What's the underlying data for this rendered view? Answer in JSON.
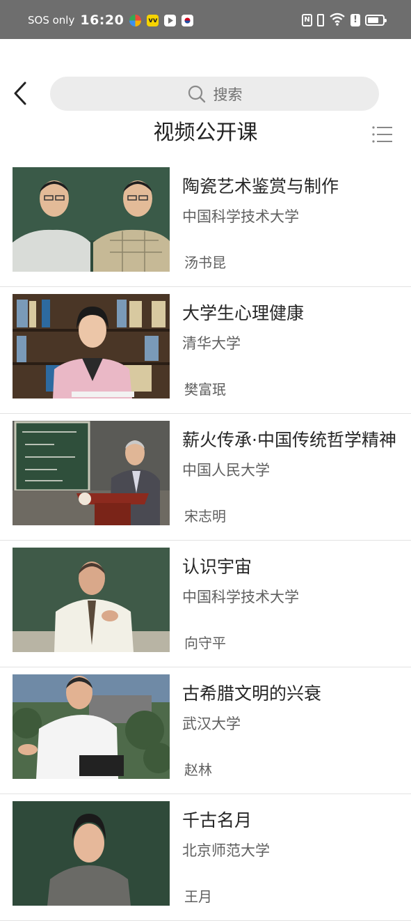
{
  "status_bar": {
    "network": "SOS only",
    "time": "16:20",
    "app_icons": [
      {
        "name": "pinwheel-app-icon",
        "color": "#f0a000"
      },
      {
        "name": "vv-app-icon",
        "color": "#f6d400"
      },
      {
        "name": "play-app-icon",
        "color": "#ffffff"
      },
      {
        "name": "flag-app-icon",
        "color": "#ffffff"
      }
    ],
    "nfc_label": "N",
    "alert_label": "!",
    "battery_level": 0.75
  },
  "header": {
    "search_placeholder": "搜索",
    "title": "视频公开课"
  },
  "courses": [
    {
      "title": "陶瓷艺术鉴赏与制作",
      "school": "中国科学技术大学",
      "teacher": "汤书昆"
    },
    {
      "title": "大学生心理健康",
      "school": "清华大学",
      "teacher": "樊富珉"
    },
    {
      "title": "薪火传承·中国传统哲学精神",
      "school": "中国人民大学",
      "teacher": "宋志明"
    },
    {
      "title": "认识宇宙",
      "school": "中国科学技术大学",
      "teacher": "向守平"
    },
    {
      "title": "古希腊文明的兴衰",
      "school": "武汉大学",
      "teacher": "赵林"
    },
    {
      "title": "千古名月",
      "school": "北京师范大学",
      "teacher": "王月"
    }
  ],
  "colors": {
    "status_bar": "#6e6e6e",
    "search_bg": "#ececec",
    "title_text": "#262626",
    "sub_text": "#5f5f5f"
  }
}
